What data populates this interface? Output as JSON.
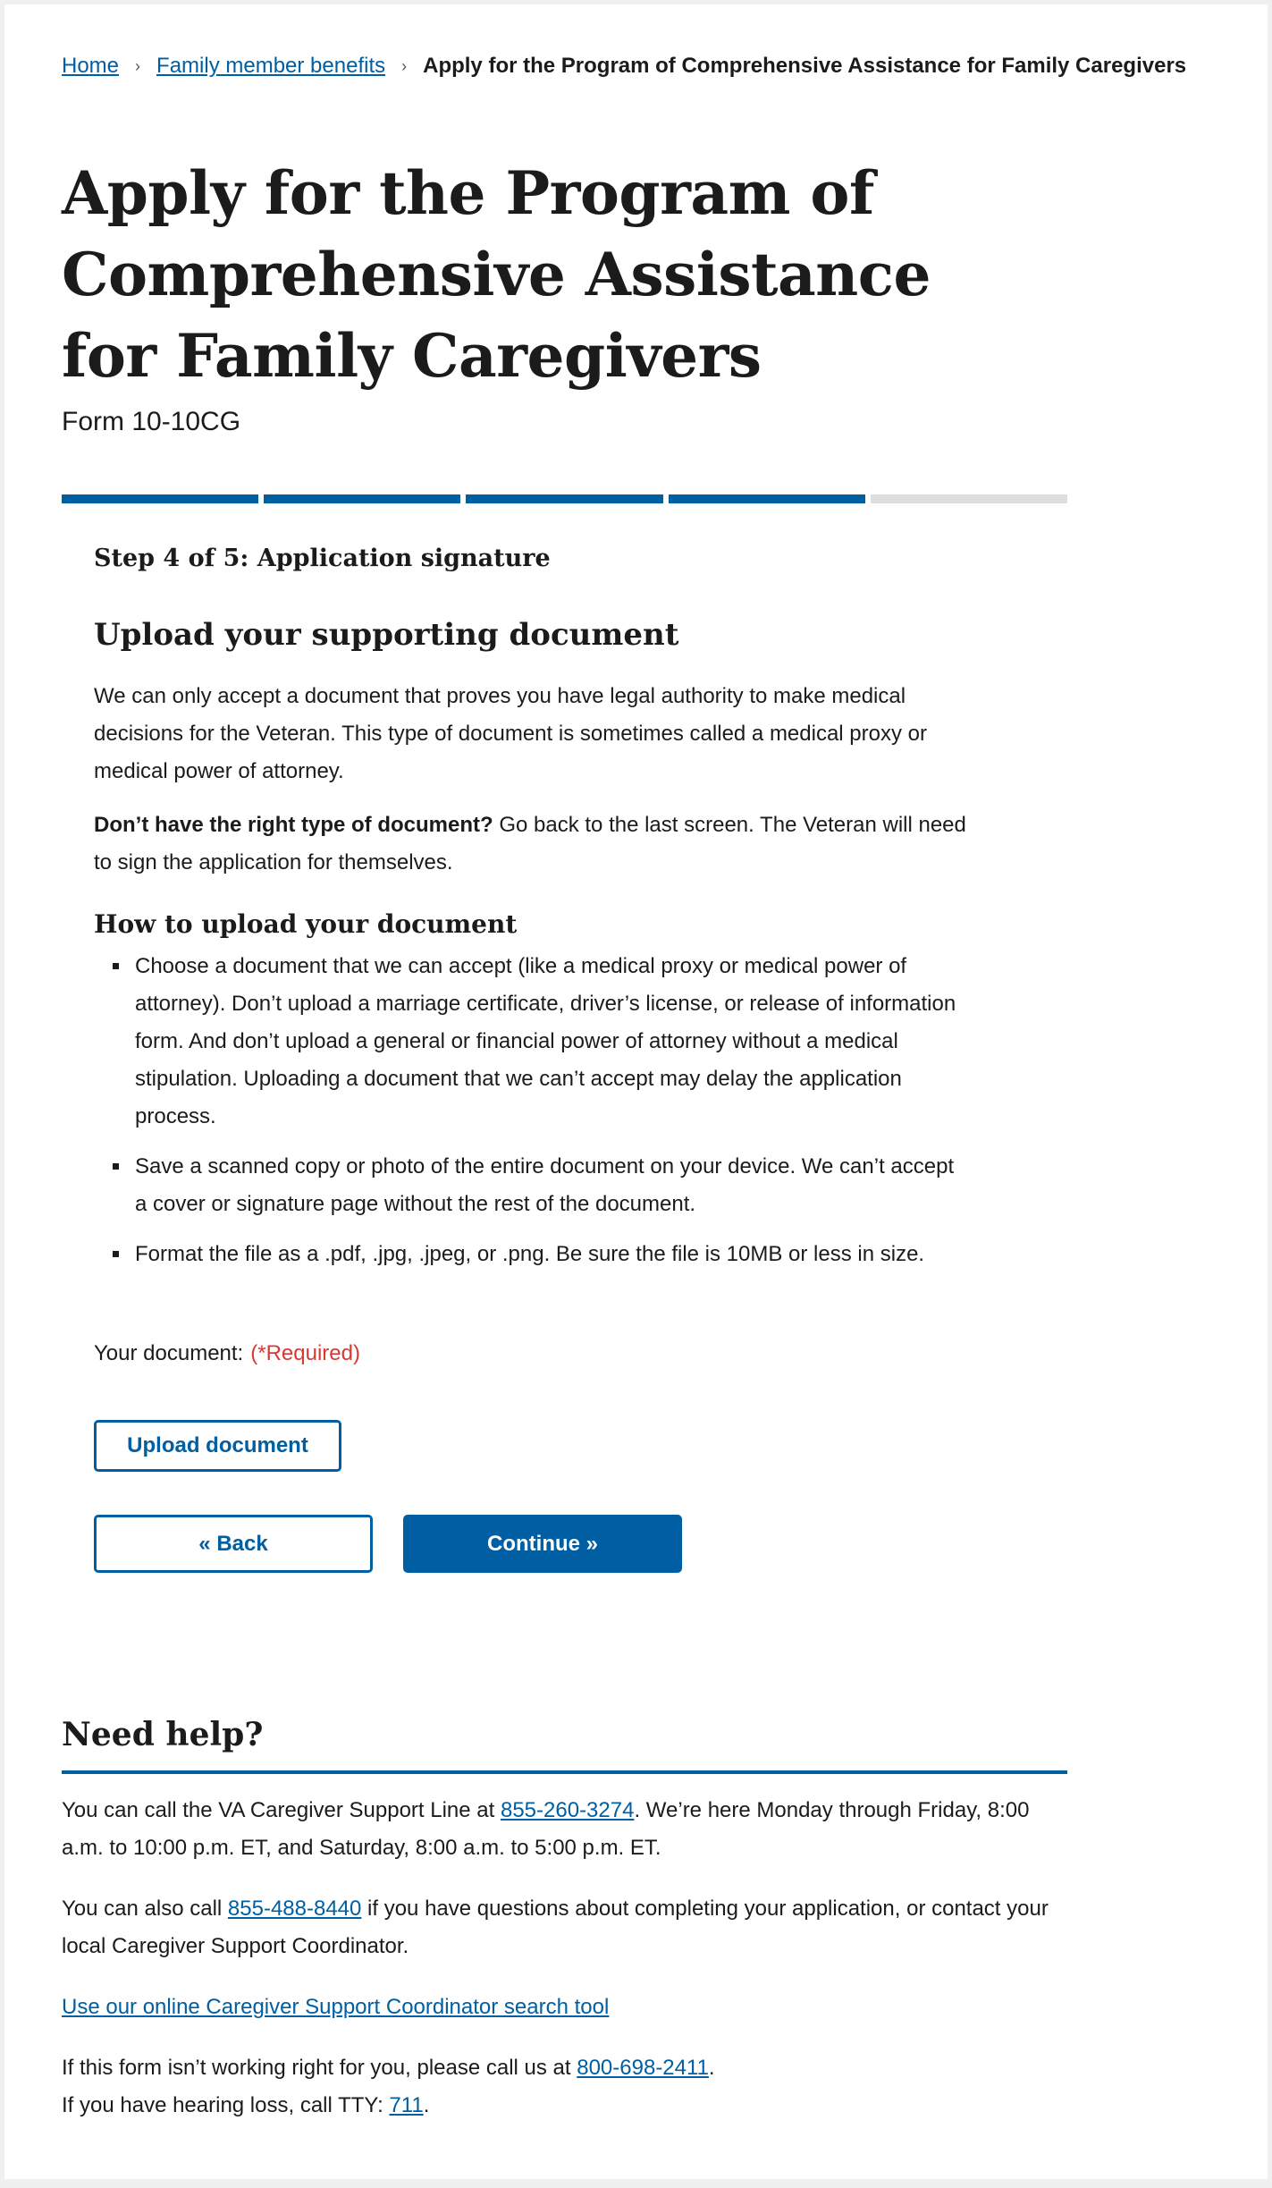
{
  "breadcrumb": {
    "home": "Home",
    "family": "Family member benefits",
    "current": "Apply for the Program of Comprehensive Assistance for Family Caregivers",
    "separator": "›"
  },
  "header": {
    "title": "Apply for the Program of Comprehensive Assistance for Family Caregivers",
    "form_number": "Form 10-10CG"
  },
  "progress": {
    "current_step": 4,
    "total_steps": 5,
    "completed_color": "#005ea2",
    "remaining_color": "#dcdee0"
  },
  "form": {
    "step_label": "Step 4 of 5: Application signature",
    "heading": "Upload your supporting document",
    "intro": "We can only accept a document that proves you have legal authority to make medical decisions for the Veteran. This type of document is sometimes called a medical proxy or medical power of attorney.",
    "no_doc_bold": "Don’t have the right type of document?",
    "no_doc_text": " Go back to the last screen. The Veteran will need to sign the application for themselves.",
    "how_heading": "How to upload your document",
    "bullets": [
      "Choose a document that we can accept (like a medical proxy or medical power of attorney). Don’t upload a marriage certificate, driver’s license, or release of information form. And don’t upload a general or financial power of attorney without a medical stipulation. Uploading a document that we can’t accept may delay the application process.",
      "Save a scanned copy or photo of the entire document on your device. We can’t accept a cover or signature page without the rest of the document.",
      "Format the file as a .pdf, .jpg, .jpeg, or .png. Be sure the file is 10MB or less in size."
    ],
    "doc_label": "Your document:",
    "required": "(*Required)",
    "upload_button": "Upload document",
    "back_button": "« Back",
    "continue_button": "Continue »"
  },
  "help": {
    "heading": "Need help?",
    "line1_pre": "You can call the VA Caregiver Support Line at ",
    "line1_phone": "855-260-3274",
    "line1_post": ". We’re here Monday through Friday, 8:00 a.m. to 10:00 p.m. ET, and Saturday, 8:00 a.m. to 5:00 p.m. ET.",
    "line2_pre": "You can also call ",
    "line2_phone": "855-488-8440",
    "line2_post": " if you have questions about completing your application, or contact your local Caregiver Support Coordinator.",
    "search_link": "Use our online Caregiver Support Coordinator search tool",
    "line3_pre": "If this form isn’t working right for you, please call us at ",
    "line3_phone": "800-698-2411",
    "line3_post": ".",
    "line4_pre": "If you have hearing loss, call TTY: ",
    "line4_phone": "711",
    "line4_post": "."
  }
}
